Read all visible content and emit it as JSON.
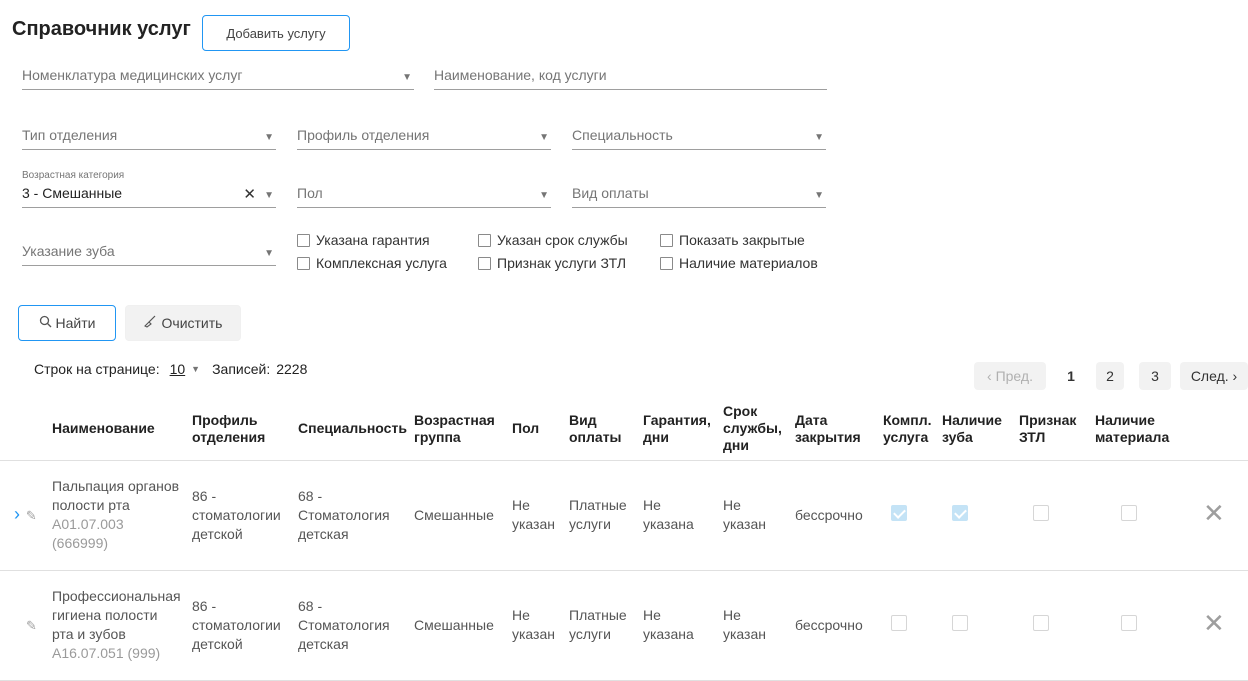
{
  "header": {
    "title": "Справочник услуг",
    "add_button": "Добавить услугу"
  },
  "filters": {
    "nomenclature": {
      "placeholder": "Номенклатура медицинских услуг"
    },
    "name_code": {
      "placeholder": "Наименование, код услуги"
    },
    "dept_type": {
      "placeholder": "Тип отделения"
    },
    "dept_profile": {
      "placeholder": "Профиль отделения"
    },
    "specialty": {
      "placeholder": "Специальность"
    },
    "age_category": {
      "label": "Возрастная категория",
      "value": "3 - Смешанные"
    },
    "sex": {
      "placeholder": "Пол"
    },
    "payment_type": {
      "placeholder": "Вид оплаты"
    },
    "tooth": {
      "placeholder": "Указание зуба"
    },
    "checkboxes": [
      "Указана гарантия",
      "Указан срок службы",
      "Показать закрытые",
      "Комплексная услуга",
      "Признак услуги ЗТЛ",
      "Наличие материалов"
    ]
  },
  "actions": {
    "find": "Найти",
    "clear": "Очистить"
  },
  "pagination": {
    "rows_label": "Строк на странице:",
    "rows_value": "10",
    "records_label": "Записей:",
    "records_value": "2228",
    "prev": "‹ Пред.",
    "pages": [
      "1",
      "2",
      "3"
    ],
    "next": "След. ›"
  },
  "table": {
    "columns": [
      "Наименование",
      "Профиль отделения",
      "Специальность",
      "Возрастная группа",
      "Пол",
      "Вид оплаты",
      "Гарантия, дни",
      "Срок службы, дни",
      "Дата закрытия",
      "Компл. услуга",
      "Наличие зуба",
      "Признак ЗТЛ",
      "Наличие материала"
    ],
    "rows": [
      {
        "name": "Пальпация органов полости рта",
        "code": "A01.07.003 (666999)",
        "profile": "86 - стоматологии детской",
        "specialty": "68 - Стоматология детская",
        "age": "Смешанные",
        "sex": "Не указан",
        "payment": "Платные услуги",
        "warranty": "Не указана",
        "service_life": "Не указан",
        "closed": "бессрочно",
        "complex": true,
        "tooth": true,
        "ztl": false,
        "material": false
      },
      {
        "name": "Профессиональная гигиена полости рта и зубов",
        "code": "A16.07.051 (999)",
        "profile": "86 - стоматологии детской",
        "specialty": "68 - Стоматология детская",
        "age": "Смешанные",
        "sex": "Не указан",
        "payment": "Платные услуги",
        "warranty": "Не указана",
        "service_life": "Не указан",
        "closed": "бессрочно",
        "complex": false,
        "tooth": false,
        "ztl": false,
        "material": false
      }
    ]
  },
  "icons": {
    "expand": "chevron-right-icon",
    "edit": "pencil-icon",
    "delete": "close-icon",
    "search": "search-icon",
    "clear": "broom-icon"
  },
  "colors": {
    "accent": "#2196f3",
    "checked": "#c4e3f6"
  }
}
